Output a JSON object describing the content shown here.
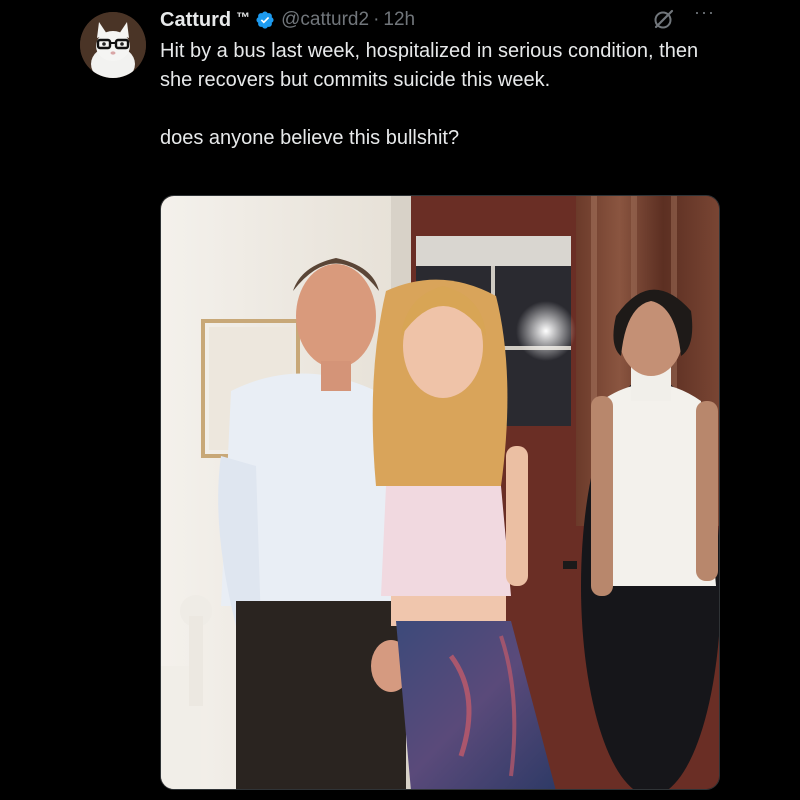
{
  "tweet": {
    "author": {
      "display_name": "Catturd",
      "badge_text": "™",
      "handle": "@catturd2",
      "separator": "·",
      "time": "12h",
      "avatar_icon": "cat-with-glasses-avatar",
      "verified_icon": "verified-badge-icon",
      "verified_color": "#1d9bf0"
    },
    "actions": {
      "grok_icon": "grok-icon",
      "more_label": "···"
    },
    "text": {
      "paragraph_1": "Hit by a bus last week, hospitalized in serious condition, then she recovers but commits suicide this week.",
      "paragraph_2": "does anyone believe this bullshit?"
    },
    "media": {
      "type": "photo"
    }
  },
  "colors": {
    "background": "#000000",
    "primary_text": "#e7e9ea",
    "secondary_text": "#71767b",
    "accent": "#1d9bf0"
  }
}
